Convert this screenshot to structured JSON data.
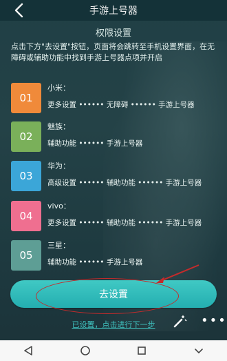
{
  "header": {
    "title": "手游上号器",
    "back_icon": "chevron-left-icon"
  },
  "section": {
    "title": "权限设置",
    "description": "点击下方\"去设置\"按钮，页面将会跳转至手机设置界面，在无障碍或辅助功能中找到手游上号器点项并开启"
  },
  "items": [
    {
      "number": "01",
      "name": "小米：",
      "path": "更多设置 •••••• 无障碍 •••••• 手游上号器",
      "color": "#f08a3a"
    },
    {
      "number": "02",
      "name": "魅族：",
      "path": "辅助功能 •••••• 手游上号器",
      "color": "#7ab05a"
    },
    {
      "number": "03",
      "name": "华为：",
      "path": "高级设置 •••••• 辅助功能 •••••• 手游上号器",
      "color": "#3ba6d8"
    },
    {
      "number": "04",
      "name": "vivo：",
      "path": "更多设置 •••••• 辅助功能 •••••• 手游上号器",
      "color": "#ef6f90"
    },
    {
      "number": "05",
      "name": "三星：",
      "path": "辅助功能 •••••• 手游上号器",
      "color": "#5e9e95"
    }
  ],
  "cta_label": "去设置",
  "footer_link": "已设置，点击进行下一步",
  "accent_color": "#2bb3b3",
  "annotation_color": "#c52b2b"
}
